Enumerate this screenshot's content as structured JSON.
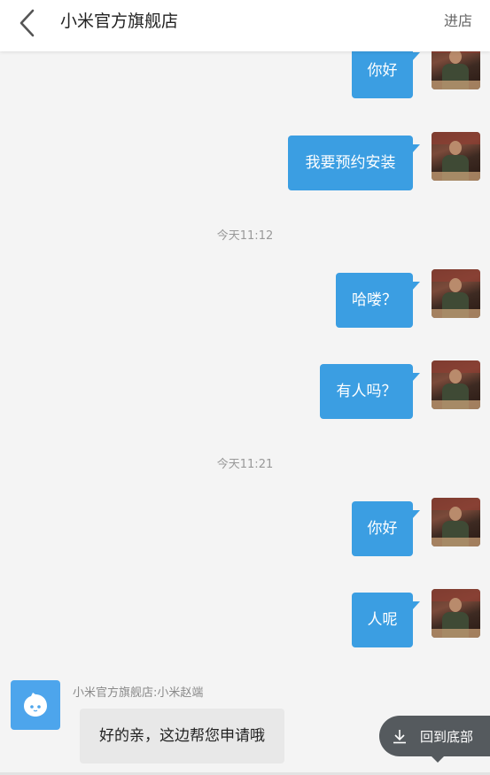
{
  "header": {
    "title": "小米官方旗舰店",
    "enter_store": "进店"
  },
  "messages": {
    "m1": "你好",
    "m2": "我要预约安装",
    "t1": "今天11:12",
    "m3": "哈喽？",
    "m4": "有人吗？",
    "t2": "今天11:21",
    "m5": "你好",
    "m6": "人呢"
  },
  "incoming": {
    "sender": "小米官方旗舰店:小米赵端",
    "text": "好的亲，这边帮您申请哦"
  },
  "scroll_button": {
    "label": "回到底部"
  },
  "colors": {
    "outgoing_bubble": "#3b9ee2",
    "incoming_bubble": "#e8e8e8",
    "background": "#f4f4f4"
  }
}
